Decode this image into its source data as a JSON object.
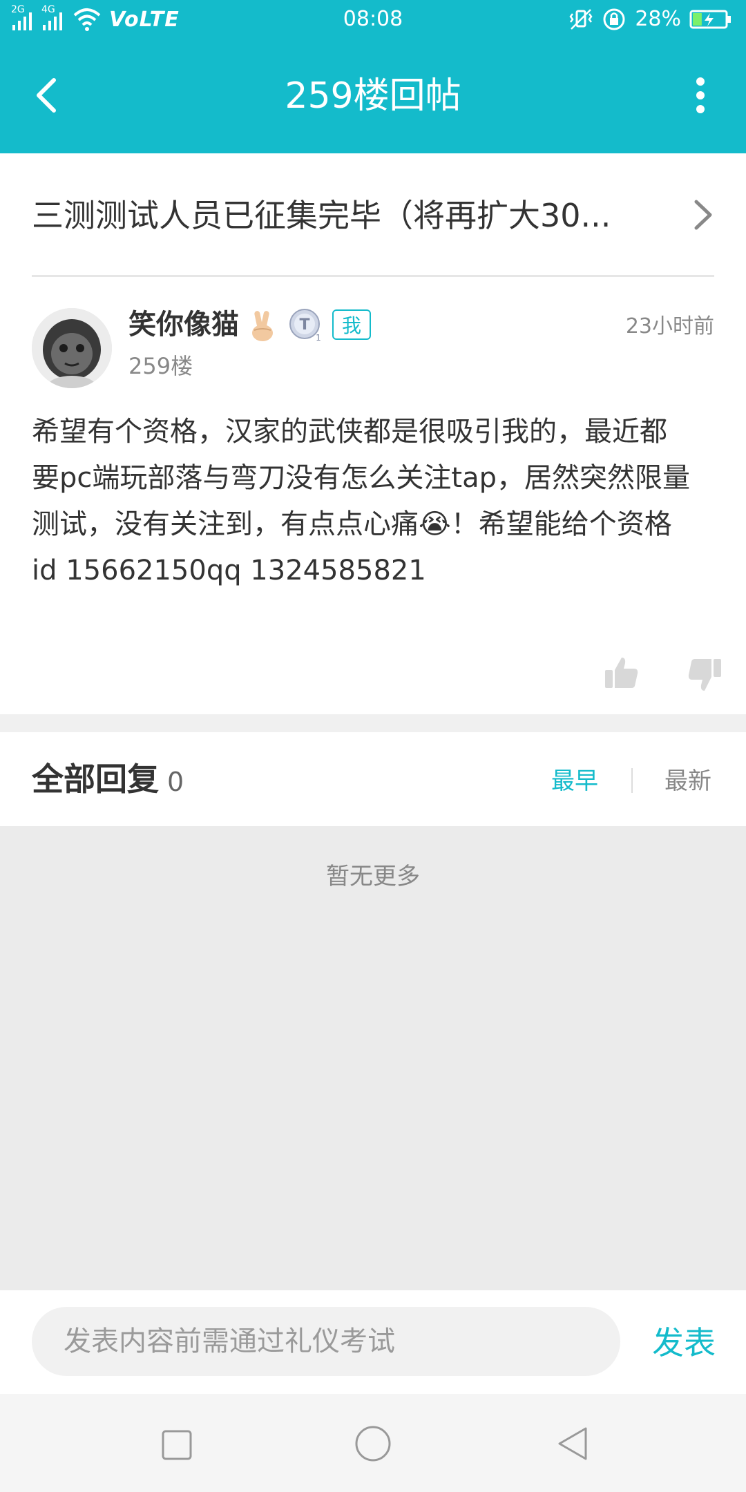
{
  "status_bar": {
    "signal_1_label": "2G",
    "signal_2_label": "4G",
    "volte": "VoLTE",
    "time": "08:08",
    "battery_percent": "28%",
    "battery_level": 0.28
  },
  "header": {
    "title": "259楼回帖"
  },
  "thread": {
    "topic_title": "三测测试人员已征集完毕（将再扩大30..."
  },
  "post": {
    "username": "笑你像猫",
    "level_badge": "T",
    "me_badge": "我",
    "time": "23小时前",
    "floor": "259楼",
    "content_lines": [
      "希望有个资格，汉家的武侠都是很吸引我的，最近都",
      "要pc端玩部落与弯刀没有怎么关注tap，居然突然限量",
      "测试，没有关注到，有点点心痛😭！希望能给个资格",
      "id   15662150qq 1324585821"
    ]
  },
  "replies": {
    "title": "全部回复",
    "count": "0",
    "sort_earliest": "最早",
    "sort_newest": "最新",
    "empty_text": "暂无更多"
  },
  "reply_bar": {
    "placeholder": "发表内容前需通过礼仪考试",
    "send_label": "发表"
  },
  "colors": {
    "accent": "#14BBCB",
    "page_bg": "#EBEBEB"
  }
}
